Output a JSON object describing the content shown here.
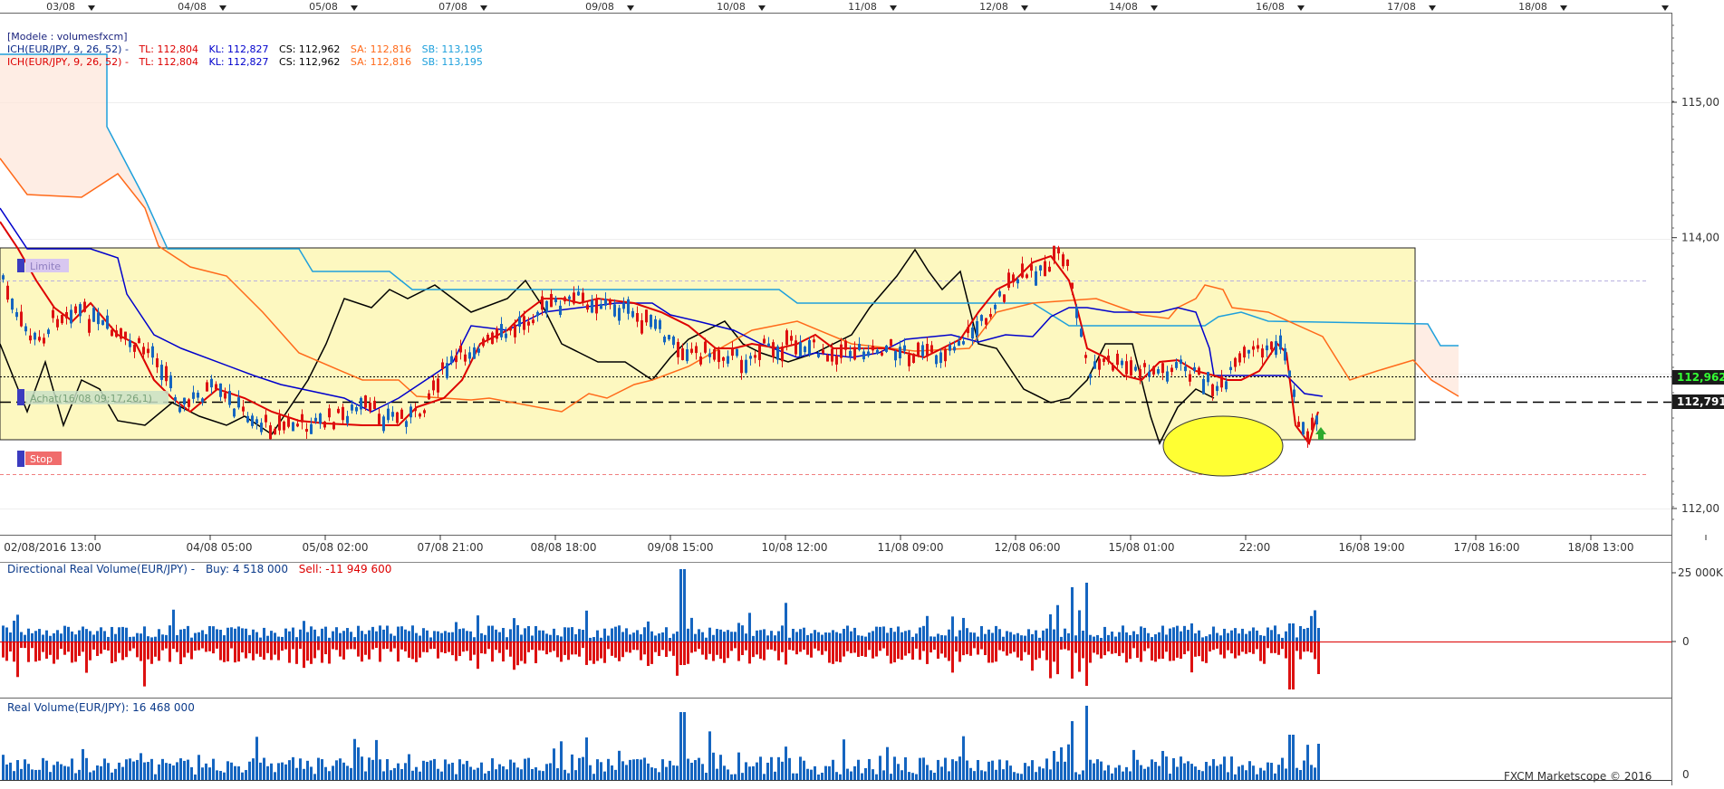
{
  "top_dates": [
    "03/08",
    "04/08",
    "05/08",
    "07/08",
    "09/08",
    "10/08",
    "11/08",
    "12/08",
    "14/08",
    "16/08",
    "17/08",
    "18/08"
  ],
  "legend": {
    "model": "[Modele : volumesfxcm]",
    "lines": [
      {
        "ich": "ICH(EUR/JPY, 9, 26, 52) -",
        "tl": "TL: 112,804",
        "kl": "KL: 112,827",
        "cs": "CS: 112,962",
        "sa": "SA: 112,816",
        "sb": "SB: 113,195"
      },
      {
        "ich": "ICH(EUR/JPY, 9, 26, 52) -",
        "tl": "TL: 112,804",
        "kl": "KL: 112,827",
        "cs": "CS: 112,962",
        "sa": "SA: 112,816",
        "sb": "SB: 113,195"
      }
    ]
  },
  "orders": {
    "limit": "Limite",
    "entry": "Achat(16/08 09:17,26,1)",
    "stop": "Stop"
  },
  "price_tags": {
    "close": "112,962",
    "entry": "112,791"
  },
  "bottom_dates": [
    "02/08/2016 13:00",
    "04/08 05:00",
    "05/08 02:00",
    "07/08 21:00",
    "08/08 18:00",
    "09/08 15:00",
    "10/08 12:00",
    "11/08 09:00",
    "12/08 06:00",
    "15/08 01:00",
    "22:00",
    "16/08 19:00",
    "17/08 16:00",
    "18/08 13:00"
  ],
  "drv": {
    "title": "Directional Real Volume(EUR/JPY) -",
    "buy": "Buy: 4 518 000",
    "sell": "Sell: -11 949 600"
  },
  "rv": {
    "title": "Real Volume(EUR/JPY): 16 468 000"
  },
  "watermark": "FXCM Marketscope © 2016",
  "colors": {
    "tenkan": "#dd0000",
    "kijun": "#0000cc",
    "chikou": "#000000",
    "senkou_a": "#ff6a1a",
    "senkou_b": "#1ea0dc",
    "buy_bar": "#1565c0",
    "sell_bar": "#dd1111",
    "range_box": "#fdf8c0",
    "highlight": "#ffff33"
  },
  "chart_data": {
    "type": "candlestick",
    "instrument": "EUR/JPY",
    "price_axis_ticks": [
      "115,00",
      "114,00",
      "112,00"
    ],
    "price_range": [
      111.9,
      115.6
    ],
    "last_close": 112.962,
    "entry_price": 112.791,
    "indicators": {
      "tenkan": 112.804,
      "kijun": 112.827,
      "chikou": 112.962,
      "senkou_a": 112.816,
      "senkou_b": 113.195
    },
    "drv_axis_ticks": [
      "25 000K",
      "0"
    ],
    "rv_axis_ticks": [
      "0"
    ]
  }
}
